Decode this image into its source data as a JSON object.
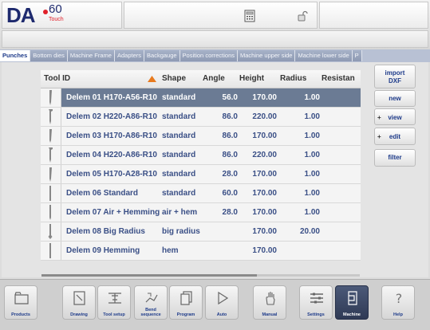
{
  "header": {
    "brand": "DA",
    "model": "60",
    "edition": "Touch"
  },
  "tabs": [
    {
      "label": "Punches",
      "active": true
    },
    {
      "label": "Bottom dies"
    },
    {
      "label": "Machine Frame"
    },
    {
      "label": "Adapters"
    },
    {
      "label": "Backgauge"
    },
    {
      "label": "Position corrections"
    },
    {
      "label": "Machine upper side"
    },
    {
      "label": "Machine lower side"
    },
    {
      "label": "P"
    }
  ],
  "table": {
    "columns": {
      "tool_id": "Tool ID",
      "shape": "Shape",
      "angle": "Angle",
      "height": "Height",
      "radius": "Radius",
      "resistance": "Resistan"
    },
    "sort_column": "Tool ID",
    "rows": [
      {
        "id": "Delem 01 H170-A56-R10",
        "shape": "standard",
        "angle": "56.0",
        "height": "170.00",
        "radius": "1.00",
        "selected": true
      },
      {
        "id": "Delem 02 H220-A86-R10",
        "shape": "standard",
        "angle": "86.0",
        "height": "220.00",
        "radius": "1.00"
      },
      {
        "id": "Delem 03 H170-A86-R10",
        "shape": "standard",
        "angle": "86.0",
        "height": "170.00",
        "radius": "1.00"
      },
      {
        "id": "Delem 04 H220-A86-R10",
        "shape": "standard",
        "angle": "86.0",
        "height": "220.00",
        "radius": "1.00"
      },
      {
        "id": "Delem 05 H170-A28-R10",
        "shape": "standard",
        "angle": "28.0",
        "height": "170.00",
        "radius": "1.00"
      },
      {
        "id": "Delem 06 Standard",
        "shape": "standard",
        "angle": "60.0",
        "height": "170.00",
        "radius": "1.00"
      },
      {
        "id": "Delem 07 Air + Hemming",
        "shape": "air + hem",
        "angle": "28.0",
        "height": "170.00",
        "radius": "1.00"
      },
      {
        "id": "Delem 08 Big Radius",
        "shape": "big radius",
        "angle": "",
        "height": "170.00",
        "radius": "20.00"
      },
      {
        "id": "Delem 09 Hemming",
        "shape": "hem",
        "angle": "",
        "height": "170.00",
        "radius": ""
      }
    ]
  },
  "side_buttons": {
    "import_line1": "import",
    "import_line2": "DXF",
    "new": "new",
    "view": "view",
    "edit": "edit",
    "filter": "filter"
  },
  "nav": [
    {
      "label": "Products",
      "icon": "folder-icon"
    },
    {
      "label": "Drawing",
      "icon": "drawing-icon"
    },
    {
      "label": "Tool setup",
      "icon": "tool-setup-icon"
    },
    {
      "label": "Bend sequence",
      "icon": "bend-sequence-icon"
    },
    {
      "label": "Program",
      "icon": "program-icon"
    },
    {
      "label": "Auto",
      "icon": "play-icon"
    },
    {
      "label": "Manual",
      "icon": "hand-icon"
    },
    {
      "label": "Settings",
      "icon": "settings-icon"
    },
    {
      "label": "Machine",
      "icon": "machine-icon",
      "active": true
    },
    {
      "label": "Help",
      "icon": "help-icon"
    }
  ],
  "colors": {
    "accent": "#1e3b8a",
    "selected_row": "#6b7b94",
    "row_text": "#3a4f86",
    "brand_red": "#e0202a"
  }
}
